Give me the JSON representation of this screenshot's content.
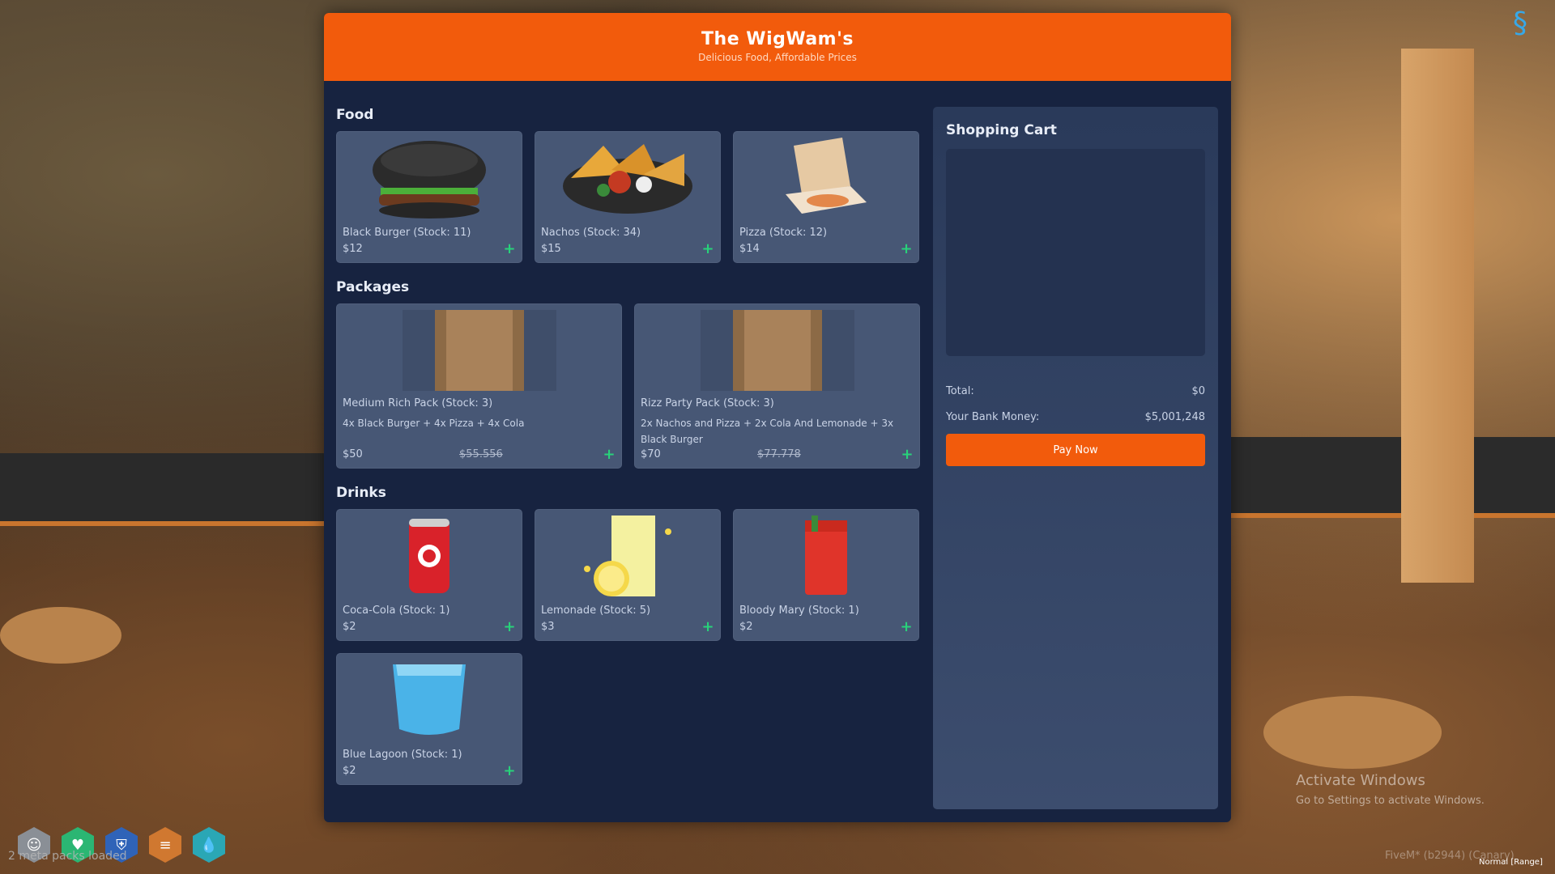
{
  "shop": {
    "title": "The WigWam's",
    "subtitle": "Delicious Food, Affordable Prices",
    "sections": {
      "food": {
        "title": "Food"
      },
      "packages": {
        "title": "Packages"
      },
      "drinks": {
        "title": "Drinks"
      }
    },
    "food": [
      {
        "name": "Black Burger (Stock: 11)",
        "price": "$12",
        "icon": "black-burger-image"
      },
      {
        "name": "Nachos (Stock: 34)",
        "price": "$15",
        "icon": "nachos-image"
      },
      {
        "name": "Pizza (Stock: 12)",
        "price": "$14",
        "icon": "pizza-box-image"
      }
    ],
    "packages": [
      {
        "name": "Medium Rich Pack (Stock: 3)",
        "desc": "4x Black Burger + 4x Pizza + 4x Cola",
        "price": "$50",
        "old_price": "$55.556",
        "icon": "paper-bag-image"
      },
      {
        "name": "Rizz Party Pack (Stock: 3)",
        "desc": "2x Nachos and Pizza + 2x Cola And Lemonade + 3x Black Burger",
        "price": "$70",
        "old_price": "$77.778",
        "icon": "paper-bag-image"
      }
    ],
    "drinks": [
      {
        "name": "Coca-Cola (Stock: 1)",
        "price": "$2",
        "icon": "cola-can-image"
      },
      {
        "name": "Lemonade (Stock: 5)",
        "price": "$3",
        "icon": "lemonade-image"
      },
      {
        "name": "Bloody Mary (Stock: 1)",
        "price": "$2",
        "icon": "bloody-mary-image"
      },
      {
        "name": "Blue Lagoon (Stock: 1)",
        "price": "$2",
        "icon": "blue-lagoon-image"
      }
    ],
    "add_label": "+"
  },
  "cart": {
    "title": "Shopping Cart",
    "total_label": "Total:",
    "total_value": "$0",
    "bank_label": "Your Bank Money:",
    "bank_value": "$5,001,248",
    "pay_label": "Pay Now"
  },
  "hud": {
    "loading_text": "2 meta packs loaded",
    "watermark_title": "Activate Windows",
    "watermark_sub": "Go to Settings to activate Windows.",
    "fivem_text": "FiveM* (b2944) (Canary)",
    "voice_text": "Normal [Range]",
    "icons": [
      "mask-icon",
      "health-icon",
      "armor-icon",
      "hunger-icon",
      "thirst-icon"
    ],
    "colors": [
      "#8a8f96",
      "#2bb673",
      "#2f63b8",
      "#d07830",
      "#2aa7b5"
    ]
  },
  "colors": {
    "accent": "#f25b0c",
    "panel": "#172340",
    "card": "#475775",
    "add": "#28d27a"
  }
}
